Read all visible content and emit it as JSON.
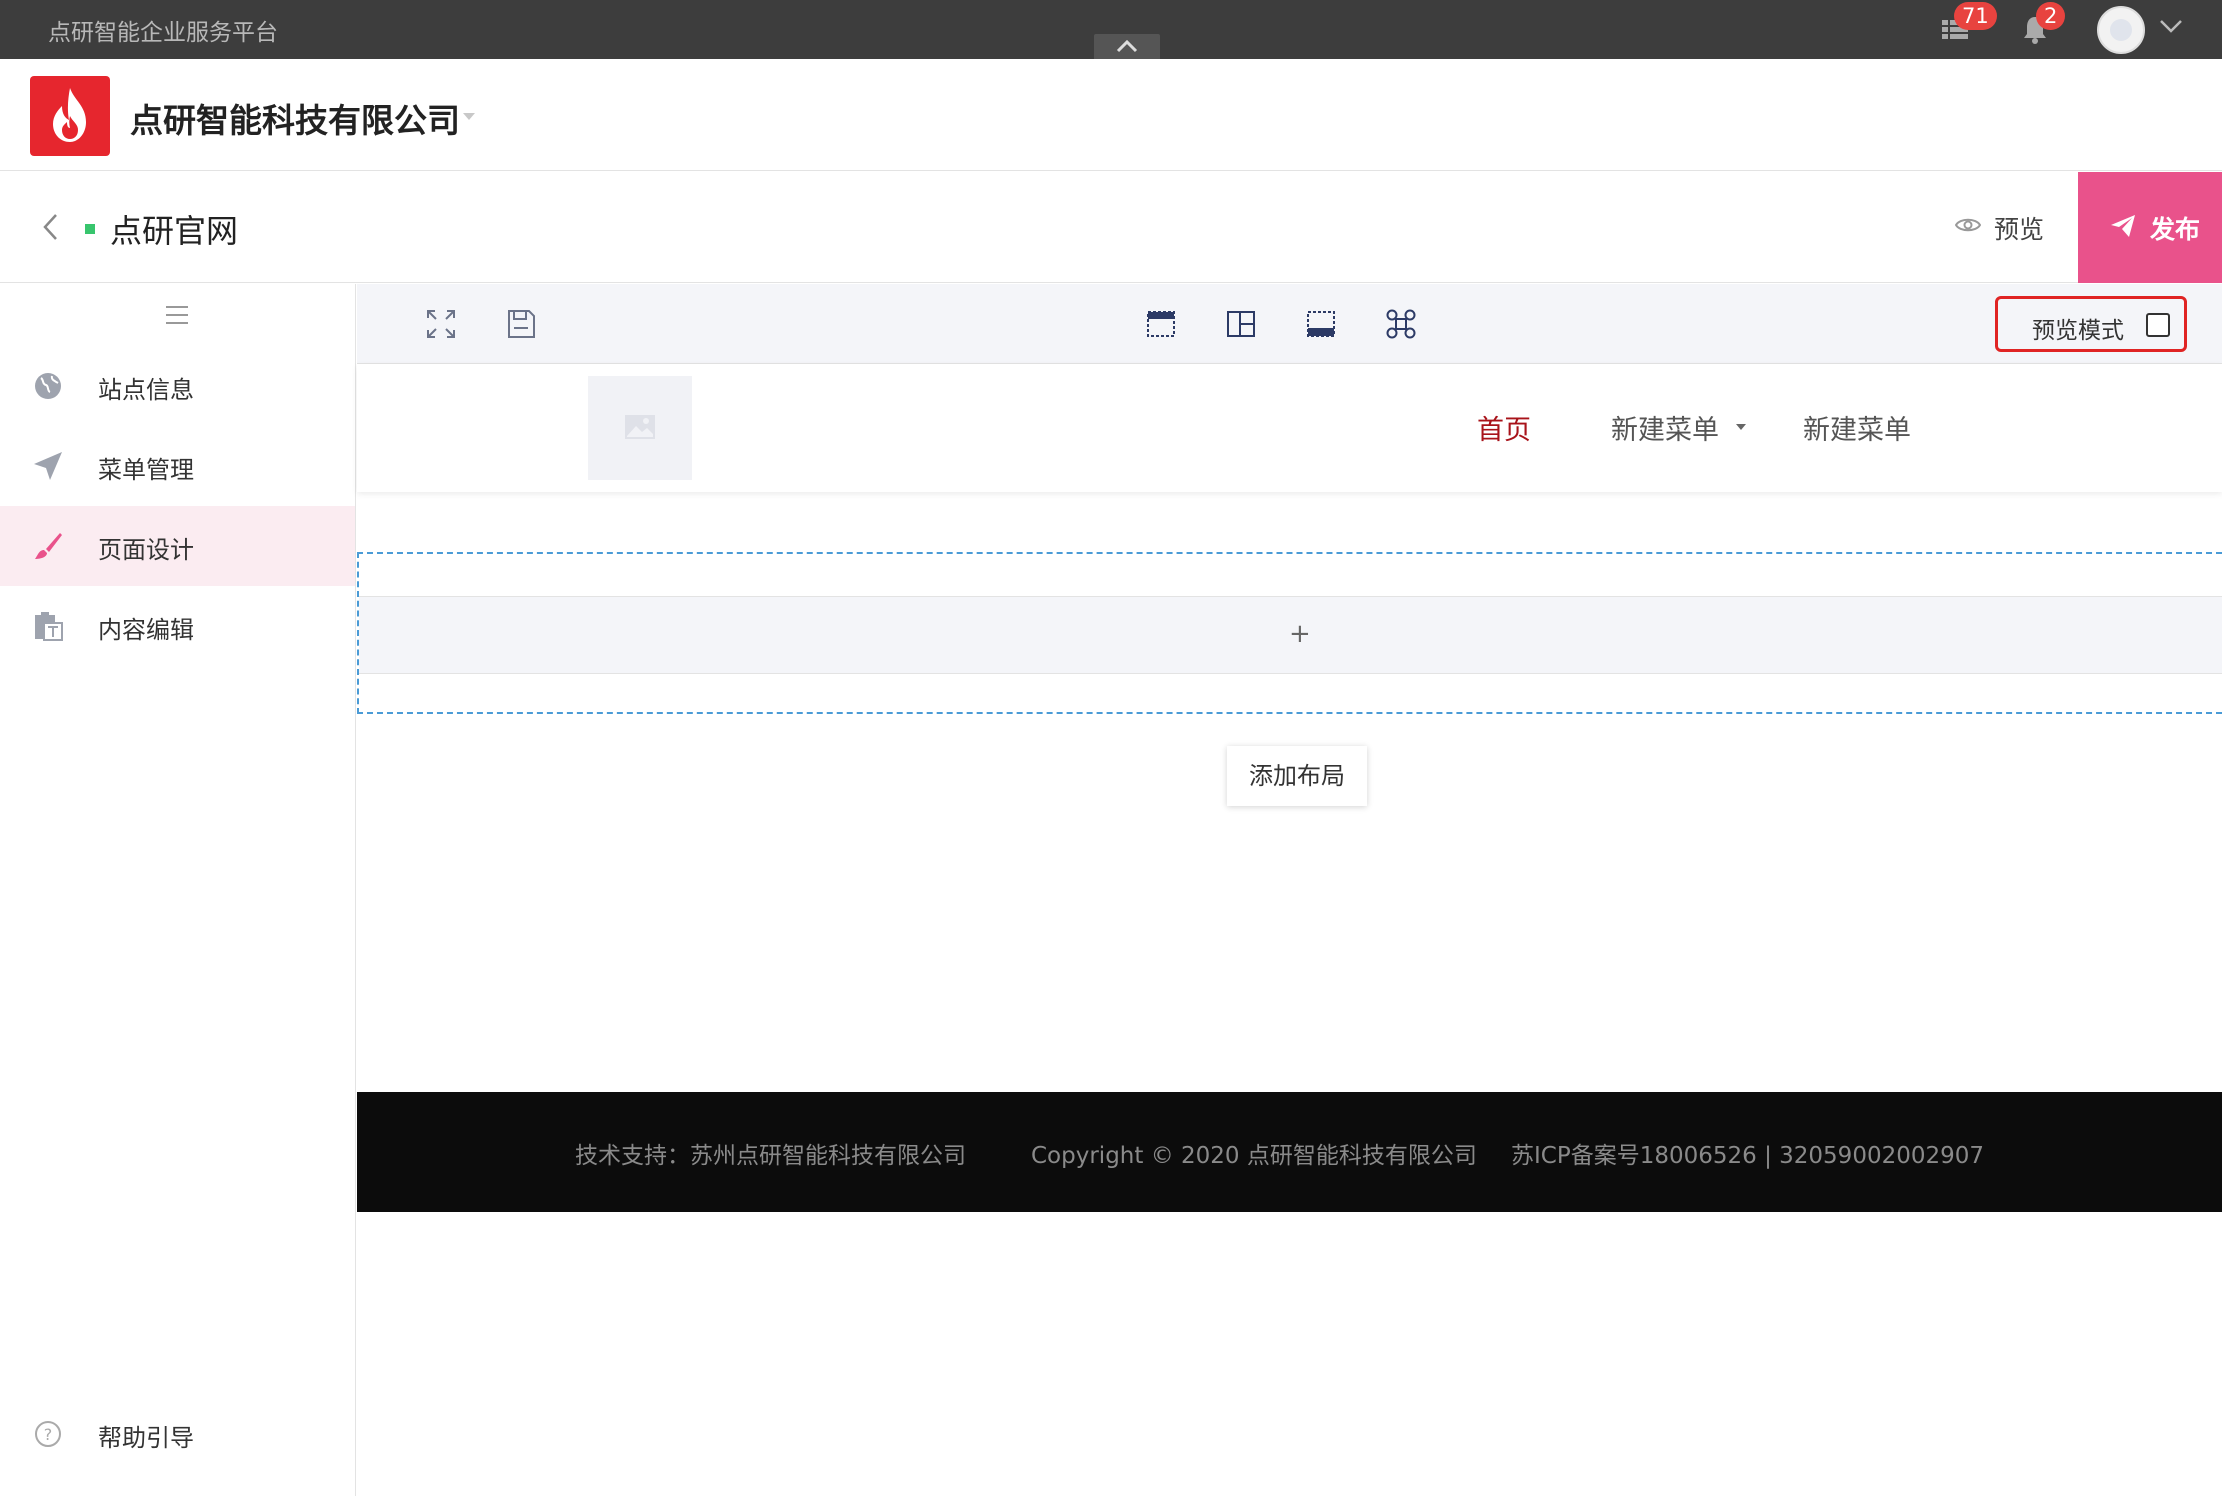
{
  "topbar": {
    "title": "点研智能企业服务平台",
    "apps_badge": "71",
    "notifications_badge": "2"
  },
  "company": {
    "name": "点研智能科技有限公司"
  },
  "pagebar": {
    "page_name": "点研官网",
    "preview_label": "预览",
    "publish_label": "发布"
  },
  "sidebar": {
    "items": [
      {
        "label": "站点信息",
        "icon": "globe-icon"
      },
      {
        "label": "菜单管理",
        "icon": "paper-plane-icon"
      },
      {
        "label": "页面设计",
        "icon": "brush-icon",
        "active": true
      },
      {
        "label": "内容编辑",
        "icon": "clipboard-text-icon"
      }
    ],
    "help_label": "帮助引导"
  },
  "toolbar": {
    "preview_mode_label": "预览模式",
    "preview_mode_checked": false
  },
  "site": {
    "nav": [
      {
        "label": "首页",
        "active": true
      },
      {
        "label": "新建菜单",
        "has_dropdown": true
      },
      {
        "label": "新建菜单"
      }
    ],
    "add_block_symbol": "+",
    "add_layout_label": "添加布局",
    "footer": {
      "support": "技术支持：苏州点研智能科技有限公司",
      "copyright": "Copyright © 2020 点研智能科技有限公司",
      "icp": "苏ICP备案号18006526 | 32059002002907"
    }
  },
  "colors": {
    "accent": "#e9528b",
    "brand_red": "#e6262e",
    "nav_active": "#a8131a",
    "highlight_border": "#e02424"
  }
}
